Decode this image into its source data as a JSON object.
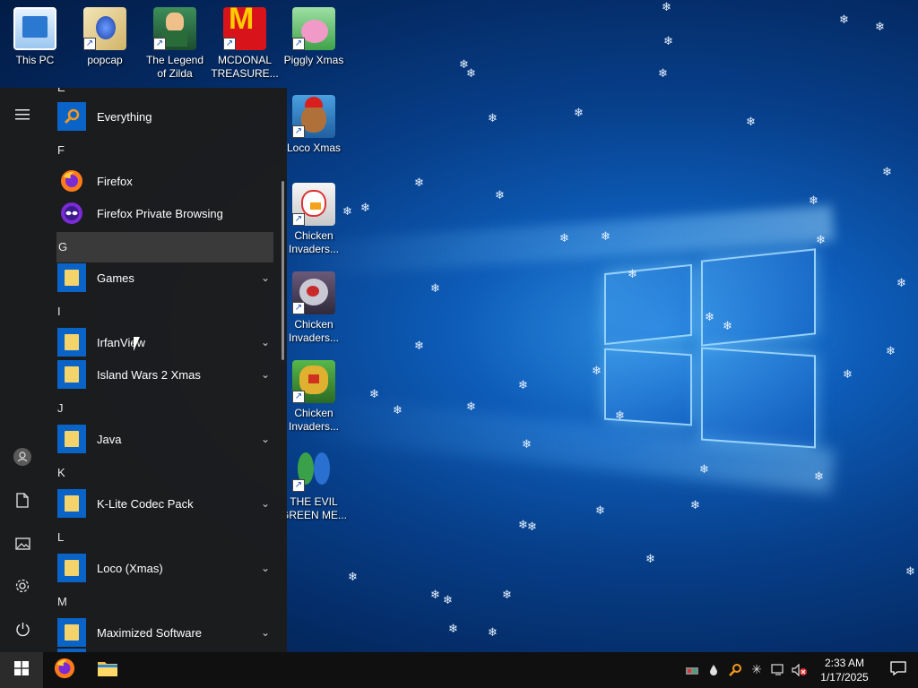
{
  "desktop": {
    "icons": [
      {
        "label": "This PC",
        "icon": "monitor-icon"
      },
      {
        "label": "popcap",
        "icon": "folder-icon"
      },
      {
        "label": "The Legend of Zilda",
        "icon": "game-icon"
      },
      {
        "label": "MCDONAL TREASURE...",
        "icon": "game-icon"
      },
      {
        "label": "Piggly Xmas",
        "icon": "game-icon"
      },
      {
        "label": "Loco Xmas",
        "icon": "game-icon"
      },
      {
        "label": "Chicken Invaders...",
        "icon": "game-icon"
      },
      {
        "label": "Chicken Invaders...",
        "icon": "game-icon"
      },
      {
        "label": "Chicken Invaders...",
        "icon": "game-icon"
      },
      {
        "label": "THE EVIL GREEN ME...",
        "icon": "game-icon"
      }
    ]
  },
  "start_menu": {
    "top_letter": "E",
    "groups": [
      {
        "letter": "",
        "apps": [
          {
            "label": "Everything",
            "icon": "search-icon",
            "expandable": false
          }
        ]
      },
      {
        "letter": "F",
        "apps": [
          {
            "label": "Firefox",
            "icon": "firefox-icon",
            "expandable": false
          },
          {
            "label": "Firefox Private Browsing",
            "icon": "firefox-private-icon",
            "expandable": false
          }
        ]
      },
      {
        "letter": "G",
        "apps": [
          {
            "label": "Games",
            "icon": "folder-icon",
            "expandable": true
          }
        ]
      },
      {
        "letter": "I",
        "apps": [
          {
            "label": "IrfanView",
            "icon": "folder-icon",
            "expandable": true
          },
          {
            "label": "Island Wars 2 Xmas",
            "icon": "folder-icon",
            "expandable": true
          }
        ]
      },
      {
        "letter": "J",
        "apps": [
          {
            "label": "Java",
            "icon": "folder-icon",
            "expandable": true
          }
        ]
      },
      {
        "letter": "K",
        "apps": [
          {
            "label": "K-Lite Codec Pack",
            "icon": "folder-icon",
            "expandable": true
          }
        ]
      },
      {
        "letter": "L",
        "apps": [
          {
            "label": "Loco (Xmas)",
            "icon": "folder-icon",
            "expandable": true
          }
        ]
      },
      {
        "letter": "M",
        "apps": [
          {
            "label": "Maximized Software",
            "icon": "folder-icon",
            "expandable": true
          }
        ]
      }
    ],
    "rail": [
      {
        "name": "expand",
        "icon": "hamburger-icon"
      },
      {
        "name": "user",
        "icon": "user-icon"
      },
      {
        "name": "documents",
        "icon": "document-icon"
      },
      {
        "name": "pictures",
        "icon": "pictures-icon"
      },
      {
        "name": "settings",
        "icon": "gear-icon"
      },
      {
        "name": "power",
        "icon": "power-icon"
      }
    ]
  },
  "taskbar": {
    "pinned": [
      {
        "name": "firefox",
        "icon": "firefox-icon"
      },
      {
        "name": "file-explorer",
        "icon": "folder-icon"
      }
    ],
    "tray": [
      "network-icon",
      "water-drop-icon",
      "search-icon",
      "snow-icon",
      "network-monitor-icon",
      "volume-muted-icon"
    ],
    "clock": {
      "time": "2:33 AM",
      "date": "1/17/2025"
    }
  },
  "colors": {
    "accent": "#0a64c8",
    "menu_bg": "#1c1c1c",
    "taskbar_bg": "#101010"
  }
}
